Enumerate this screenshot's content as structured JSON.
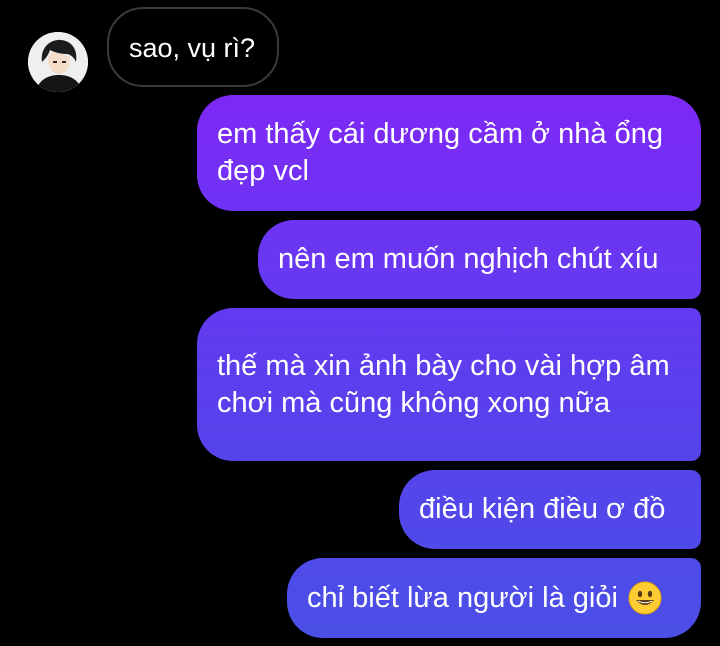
{
  "contact": {
    "avatar_icon": "profile-photo"
  },
  "messages": [
    {
      "direction": "incoming",
      "text": "sao, vụ rì?"
    },
    {
      "direction": "outgoing",
      "text": "em thấy cái dương cầm ở nhà ổng đẹp vcl"
    },
    {
      "direction": "outgoing",
      "text": "nên em muốn nghịch chút xíu"
    },
    {
      "direction": "outgoing",
      "text": "thế mà xin ảnh bày cho vài hợp âm chơi mà cũng không xong nữa"
    },
    {
      "direction": "outgoing",
      "text": "điều kiện điều ơ đồ"
    },
    {
      "direction": "outgoing",
      "text": "chỉ biết lừa người là giỏi",
      "emoji": "grinning-face-emoji"
    }
  ],
  "colors": {
    "background": "#000000",
    "incoming_border": "#3a3a3a",
    "gradient_top": "#8a1ff8",
    "gradient_bottom": "#4a50e6"
  }
}
